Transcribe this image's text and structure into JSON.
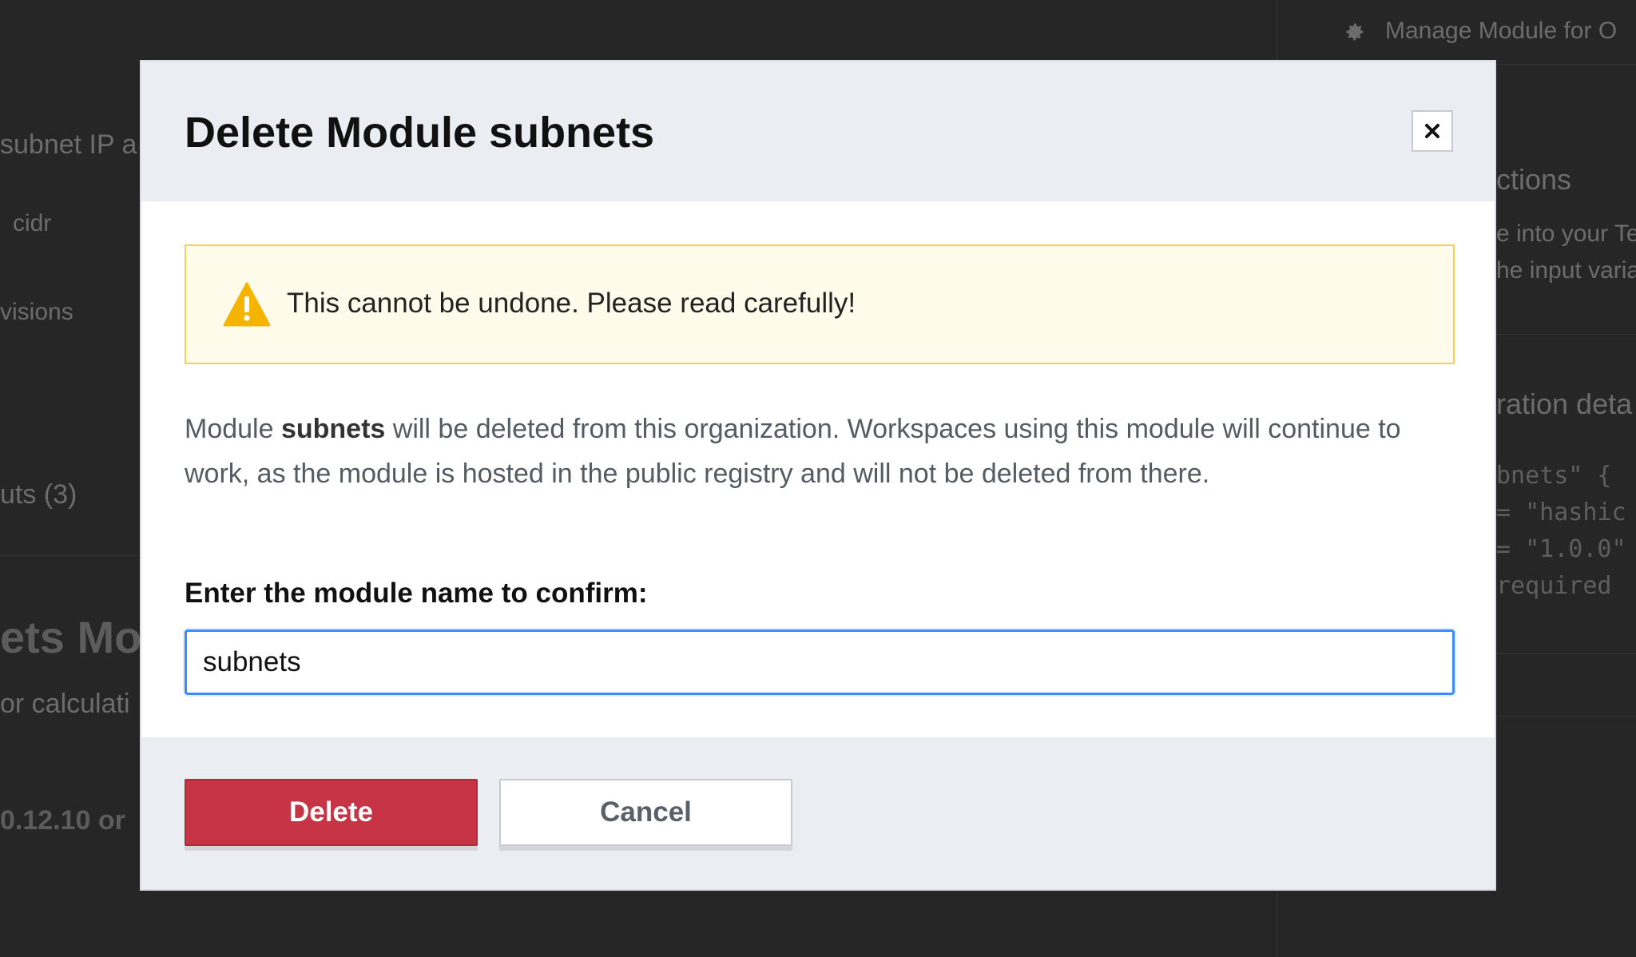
{
  "background": {
    "manage_label": "Manage Module for O",
    "left_fragments": [
      "subnet IP a",
      "cidr",
      "visions",
      "uts (3)",
      "ets Mod",
      "or calculati",
      "0.12.10 or"
    ],
    "right_fragments": [
      "ctions",
      "e into your Te",
      "he input varia",
      "ration deta"
    ],
    "code_lines": [
      "bnets\" {",
      "= \"hashic",
      "= \"1.0.0\"",
      " required"
    ]
  },
  "modal": {
    "title": "Delete Module subnets",
    "close_icon": "close-icon",
    "warning": {
      "icon": "warning-triangle-icon",
      "text": "This cannot be undone. Please read carefully!"
    },
    "description": {
      "prefix": "Module ",
      "module_name": "subnets",
      "suffix": " will be deleted from this organization. Workspaces using this module will continue to work, as the module is hosted in the public registry and will not be deleted from there."
    },
    "confirm_label": "Enter the module name to confirm:",
    "confirm_input_value": "subnets",
    "buttons": {
      "delete": "Delete",
      "cancel": "Cancel"
    }
  },
  "colors": {
    "danger": "#c73445",
    "warning_bg": "#fffbeb",
    "warning_border": "#f5cf57",
    "focus": "#3a8bfd"
  }
}
